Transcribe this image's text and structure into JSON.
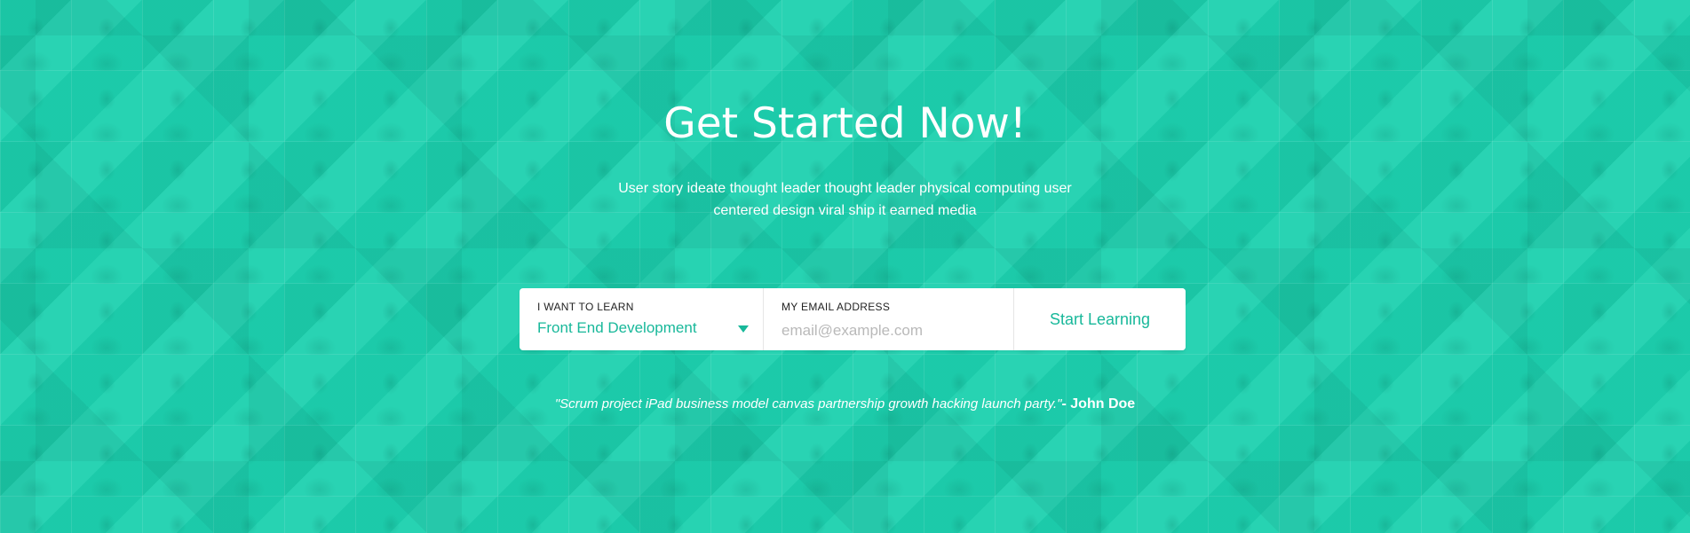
{
  "hero": {
    "title": "Get Started Now!",
    "subtitle": "User story ideate thought leader thought leader physical computing user centered design viral ship it earned media",
    "background_color": "#1ed1af",
    "accent_color": "#18b89a"
  },
  "form": {
    "learn_label": "I WANT TO LEARN",
    "learn_selected": "Front End Development",
    "learn_icon": "chevron-down-icon",
    "email_label": "MY EMAIL ADDRESS",
    "email_placeholder": "email@example.com",
    "email_value": "",
    "submit_label": "Start Learning"
  },
  "testimonial": {
    "quote": "\"Scrum project iPad business model canvas partnership growth hacking launch party.\"",
    "author": "- John Doe"
  }
}
